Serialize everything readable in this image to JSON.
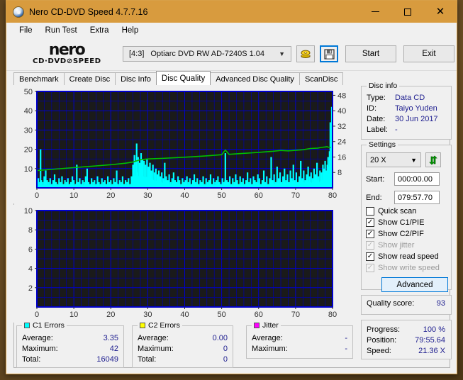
{
  "window": {
    "title": "Nero CD-DVD Speed 4.7.7.16",
    "app_icon": "nero-disc-icon",
    "controls": {
      "minimize": "—",
      "maximize": "□",
      "close": "✕"
    },
    "titlebar_color": "#d89b3e"
  },
  "menubar": {
    "items": [
      "File",
      "Run Test",
      "Extra",
      "Help"
    ]
  },
  "toolbar": {
    "logo_main": "nero",
    "logo_sub": "CD·DVD⊘SPEED",
    "drive_bracket": "[4:3]",
    "drive_name": "Optiarc DVD RW AD-7240S 1.04",
    "chevron": "⌄",
    "eject_icon": "eject-disc-icon",
    "save_icon": "floppy-save-icon",
    "start_label": "Start",
    "exit_label": "Exit"
  },
  "tabs": {
    "items": [
      "Benchmark",
      "Create Disc",
      "Disc Info",
      "Disc Quality",
      "Advanced Disc Quality",
      "ScanDisc"
    ],
    "active": "Disc Quality"
  },
  "disc_info": {
    "title": "Disc info",
    "rows": [
      {
        "key": "Type:",
        "value": "Data CD"
      },
      {
        "key": "ID:",
        "value": "Taiyo Yuden"
      },
      {
        "key": "Date:",
        "value": "30 Jun 2017"
      },
      {
        "key": "Label:",
        "value": "-"
      }
    ]
  },
  "settings": {
    "title": "Settings",
    "speed_value": "20 X",
    "speed_chevron": "⌄",
    "refresh_icon": "refresh-arrows-icon",
    "start_label": "Start:",
    "start_value": "000:00.00",
    "end_label": "End:",
    "end_value": "079:57.70",
    "checkboxes": [
      {
        "label": "Quick scan",
        "checked": false,
        "disabled": false
      },
      {
        "label": "Show C1/PIE",
        "checked": true,
        "disabled": false
      },
      {
        "label": "Show C2/PIF",
        "checked": true,
        "disabled": false
      },
      {
        "label": "Show jitter",
        "checked": true,
        "disabled": true
      },
      {
        "label": "Show read speed",
        "checked": true,
        "disabled": false
      },
      {
        "label": "Show write speed",
        "checked": true,
        "disabled": true
      }
    ],
    "advanced_label": "Advanced"
  },
  "quality": {
    "label": "Quality score:",
    "value": "93"
  },
  "progress": {
    "rows": [
      {
        "key": "Progress:",
        "value": "100 %"
      },
      {
        "key": "Position:",
        "value": "79:55.64"
      },
      {
        "key": "Speed:",
        "value": "21.36 X"
      }
    ]
  },
  "stats": {
    "c1": {
      "title": "C1 Errors",
      "swatch": "#00ffff",
      "rows": [
        {
          "key": "Average:",
          "value": "3.35"
        },
        {
          "key": "Maximum:",
          "value": "42"
        },
        {
          "key": "Total:",
          "value": "16049"
        }
      ]
    },
    "c2": {
      "title": "C2 Errors",
      "swatch": "#ffff00",
      "rows": [
        {
          "key": "Average:",
          "value": "0.00"
        },
        {
          "key": "Maximum:",
          "value": "0"
        },
        {
          "key": "Total:",
          "value": "0"
        }
      ]
    },
    "jitter": {
      "title": "Jitter",
      "swatch": "#ff00ff",
      "rows": [
        {
          "key": "Average:",
          "value": "-"
        },
        {
          "key": "Maximum:",
          "value": "-"
        }
      ]
    }
  },
  "chart_data": [
    {
      "id": "c1-errors-chart",
      "type": "area",
      "title": "C1 Errors / read speed vs disc position",
      "xlabel": "",
      "ylabel": "",
      "xlim": [
        0,
        80
      ],
      "ylim": [
        0,
        50
      ],
      "y2lim": [
        0,
        50
      ],
      "grid": true,
      "background": "#1a1a1a",
      "grid_color": "#0000cd",
      "xticks": [
        0,
        10,
        20,
        30,
        40,
        50,
        60,
        70,
        80
      ],
      "yticks": [
        10,
        20,
        30,
        40,
        50
      ],
      "y2ticks": [
        8,
        16,
        24,
        32,
        40,
        48
      ],
      "series": [
        {
          "name": "C1 Errors",
          "color": "#00ffff",
          "kind": "area",
          "x": [
            0,
            0.4,
            0.8,
            1.0,
            1.2,
            1.6,
            2.0,
            2.4,
            2.8,
            3.2,
            3.6,
            4.0,
            4.4,
            4.8,
            5.2,
            5.6,
            6.0,
            6.4,
            6.8,
            7.2,
            7.6,
            8.0,
            8.4,
            8.8,
            9.2,
            9.6,
            10.0,
            10.4,
            10.8,
            11.2,
            11.6,
            12.0,
            12.4,
            12.8,
            13.2,
            13.6,
            14.0,
            14.4,
            14.8,
            15.2,
            15.6,
            16.0,
            16.4,
            16.8,
            17.2,
            17.6,
            18.0,
            18.4,
            18.8,
            19.2,
            19.6,
            20.0,
            20.4,
            20.8,
            21.2,
            21.6,
            22.0,
            22.4,
            22.8,
            23.2,
            23.6,
            24.0,
            24.4,
            24.8,
            25.2,
            25.6,
            26.0,
            26.4,
            26.8,
            27.0,
            27.4,
            27.8,
            28.2,
            28.6,
            29.0,
            29.4,
            29.8,
            30.2,
            30.6,
            31.0,
            31.4,
            31.8,
            32.2,
            32.6,
            33.0,
            33.4,
            33.8,
            34.2,
            34.6,
            35.0,
            35.4,
            35.8,
            36.2,
            36.6,
            37.0,
            37.4,
            37.8,
            38.2,
            38.6,
            39.0,
            39.4,
            39.8,
            40.2,
            40.6,
            41.0,
            41.4,
            41.8,
            42.2,
            42.6,
            43.0,
            43.4,
            43.8,
            44.2,
            44.6,
            45.0,
            45.4,
            45.8,
            46.2,
            46.6,
            47.0,
            47.4,
            47.8,
            48.2,
            48.6,
            49.0,
            49.4,
            49.8,
            50.2,
            50.6,
            51.0,
            51.4,
            51.8,
            52.2,
            52.6,
            53.0,
            53.4,
            53.8,
            54.2,
            54.6,
            55.0,
            55.4,
            55.8,
            56.2,
            56.6,
            57.0,
            57.4,
            57.8,
            58.2,
            58.6,
            59.0,
            59.4,
            59.8,
            60.2,
            60.6,
            61.0,
            61.4,
            61.8,
            62.2,
            62.6,
            63.0,
            63.4,
            63.8,
            64.2,
            64.6,
            65.0,
            65.4,
            65.8,
            66.2,
            66.6,
            67.0,
            67.4,
            67.8,
            68.2,
            68.6,
            69.0,
            69.4,
            69.8,
            70.2,
            70.6,
            71.0,
            71.4,
            71.8,
            72.2,
            72.6,
            73.0,
            73.4,
            73.8,
            74.2,
            74.6,
            75.0,
            75.4,
            75.8,
            76.2,
            76.6,
            77.0,
            77.4,
            77.8,
            78.0,
            78.3,
            78.6,
            78.8,
            79.0,
            79.2,
            79.4,
            79.6,
            79.8,
            80.0
          ],
          "y": [
            9,
            5,
            3,
            20,
            4,
            3,
            6,
            9,
            4,
            3,
            5,
            2,
            4,
            7,
            3,
            2,
            5,
            3,
            6,
            2,
            4,
            3,
            5,
            2,
            3,
            6,
            4,
            2,
            12,
            3,
            5,
            2,
            4,
            3,
            6,
            10,
            3,
            2,
            5,
            3,
            4,
            2,
            6,
            3,
            2,
            5,
            3,
            4,
            2,
            6,
            3,
            4,
            2,
            5,
            3,
            9,
            2,
            4,
            3,
            6,
            2,
            4,
            3,
            5,
            2,
            6,
            12,
            17,
            14,
            23,
            16,
            13,
            18,
            15,
            14,
            12,
            15,
            11,
            13,
            9,
            12,
            8,
            10,
            7,
            9,
            6,
            8,
            5,
            13,
            6,
            4,
            7,
            3,
            5,
            8,
            4,
            3,
            6,
            4,
            2,
            5,
            3,
            4,
            6,
            3,
            5,
            2,
            4,
            7,
            3,
            5,
            2,
            4,
            3,
            6,
            2,
            5,
            3,
            4,
            7,
            2,
            5,
            3,
            4,
            6,
            3,
            2,
            5,
            3,
            18,
            4,
            3,
            6,
            2,
            5,
            3,
            7,
            4,
            2,
            6,
            3,
            5,
            2,
            4,
            8,
            3,
            5,
            2,
            6,
            4,
            3,
            7,
            5,
            2,
            4,
            9,
            3,
            6,
            2,
            5,
            16,
            4,
            7,
            3,
            11,
            5,
            8,
            3,
            6,
            10,
            4,
            7,
            3,
            9,
            5,
            12,
            4,
            8,
            3,
            6,
            14,
            5,
            9,
            4,
            7,
            11,
            6,
            8,
            5,
            10,
            7,
            13,
            6,
            9,
            8,
            12,
            10,
            14,
            9,
            12,
            16,
            11,
            19,
            34,
            14,
            42,
            10,
            13,
            11,
            9,
            8
          ]
        },
        {
          "name": "Read speed",
          "color": "#00c000",
          "kind": "line",
          "x": [
            0,
            4,
            8,
            12,
            16,
            20,
            24,
            26,
            28,
            30,
            34,
            38,
            42,
            46,
            50,
            51,
            52,
            56,
            60,
            64,
            66,
            68,
            72,
            74,
            76,
            77,
            78,
            78.5,
            79,
            79.5
          ],
          "y": [
            9.0,
            9.6,
            10.2,
            10.8,
            11.4,
            12.0,
            12.8,
            13.4,
            14.6,
            15.0,
            15.3,
            15.7,
            16.1,
            16.6,
            17.2,
            19.6,
            17.4,
            17.9,
            18.4,
            19.0,
            19.4,
            19.2,
            19.8,
            20.4,
            20.6,
            21.0,
            21.2,
            21.4,
            21.0,
            21.0
          ]
        }
      ]
    },
    {
      "id": "c2-errors-chart",
      "type": "area",
      "title": "C2 Errors vs disc position",
      "xlabel": "",
      "ylabel": "",
      "xlim": [
        0,
        80
      ],
      "ylim": [
        0,
        10
      ],
      "grid": true,
      "background": "#1a1a1a",
      "grid_color": "#0000cd",
      "xticks": [
        0,
        10,
        20,
        30,
        40,
        50,
        60,
        70,
        80
      ],
      "yticks": [
        2,
        4,
        6,
        8,
        10
      ],
      "series": [
        {
          "name": "C2 Errors",
          "color": "#ffff00",
          "kind": "area",
          "x": [],
          "y": []
        }
      ]
    }
  ]
}
